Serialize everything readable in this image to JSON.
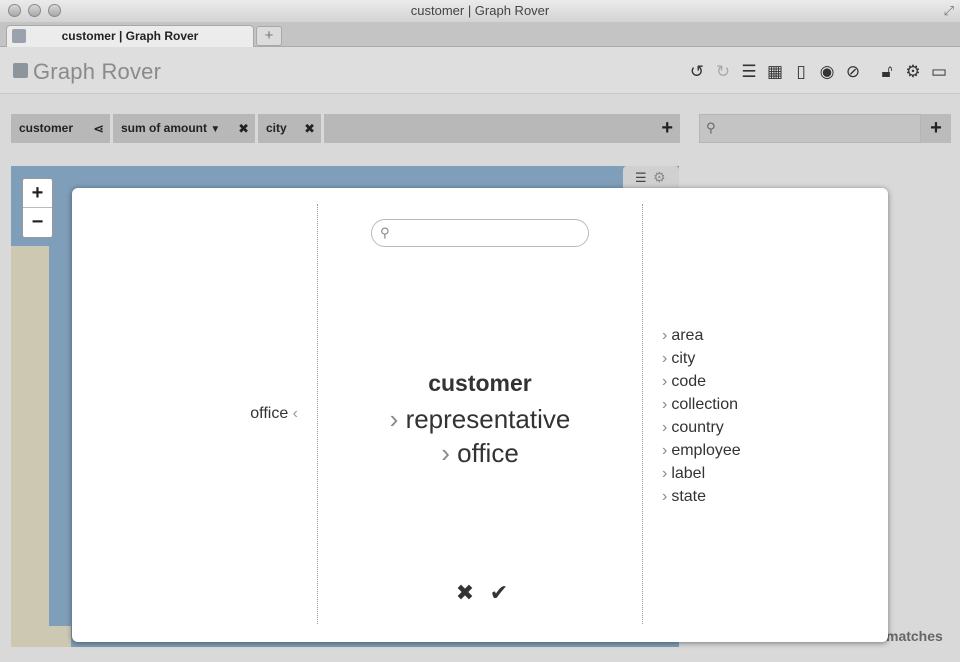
{
  "window": {
    "title": "customer | Graph Rover"
  },
  "tabs": [
    {
      "label": "customer | Graph Rover"
    }
  ],
  "app": {
    "title": "Graph Rover"
  },
  "toolbar": {
    "icons": [
      "undo-icon",
      "redo-icon",
      "list-icon",
      "calendar-icon",
      "book-icon",
      "eye-icon",
      "compass-icon",
      "lock-icon",
      "gear-icon",
      "folder-icon"
    ]
  },
  "query_bar": {
    "pills": [
      {
        "label": "customer",
        "action": "share"
      },
      {
        "label": "sum of amount",
        "action": "dropdown-close"
      },
      {
        "label": "city",
        "action": "close"
      }
    ],
    "search_placeholder": ""
  },
  "map": {
    "zoom_in": "+",
    "zoom_out": "−",
    "status_text": "matches"
  },
  "modal": {
    "search_placeholder": "",
    "incoming": [
      {
        "label": "office",
        "chevron": "‹"
      }
    ],
    "current": {
      "root": "customer",
      "path": [
        {
          "chevron": "›",
          "label": "representative"
        },
        {
          "chevron": "›",
          "label": "office"
        }
      ]
    },
    "outgoing": [
      {
        "chevron": "›",
        "label": "area"
      },
      {
        "chevron": "›",
        "label": "city"
      },
      {
        "chevron": "›",
        "label": "code"
      },
      {
        "chevron": "›",
        "label": "collection"
      },
      {
        "chevron": "›",
        "label": "country"
      },
      {
        "chevron": "›",
        "label": "employee"
      },
      {
        "chevron": "›",
        "label": "label"
      },
      {
        "chevron": "›",
        "label": "state"
      }
    ],
    "cancel_symbol": "✖",
    "confirm_symbol": "✔"
  },
  "colors": {
    "map_water": "#7f9eb9",
    "map_land": "#cdc8b2",
    "pill": "#b8b8b8"
  }
}
